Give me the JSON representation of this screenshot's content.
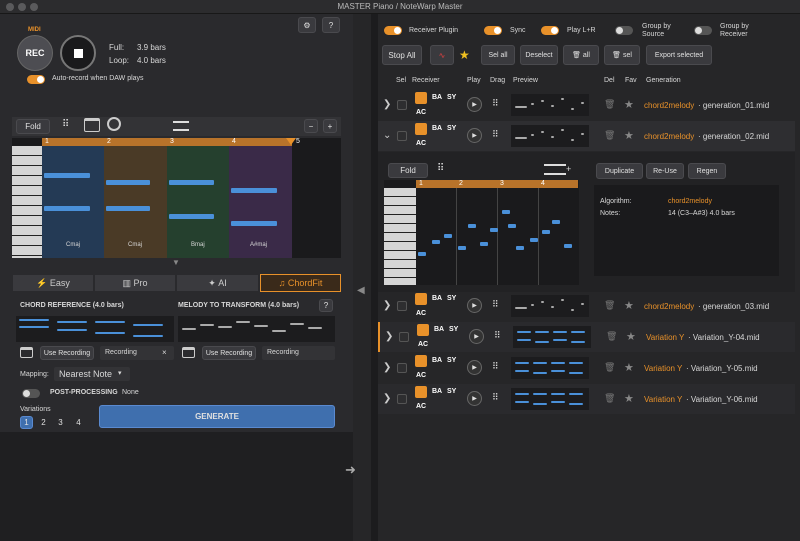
{
  "window": {
    "title": "MASTER Piano / NoteWarp Master"
  },
  "recorder": {
    "midi": "MIDI",
    "rec": "REC",
    "full_label": "Full:",
    "full_value": "3.9 bars",
    "loop_label": "Loop:",
    "loop_value": "4.0 bars",
    "auto_record": "Auto-record when DAW plays"
  },
  "top_icons": {
    "settings": "⚙",
    "help": "?"
  },
  "roll_toolbar": {
    "fold": "Fold",
    "minus": "−",
    "plus": "+"
  },
  "piano_roll": {
    "bars": [
      "1",
      "2",
      "3",
      "4",
      "5"
    ],
    "chords": [
      "Cmaj",
      "Cmaj",
      "Bmaj",
      "A#maj"
    ]
  },
  "tabs": [
    {
      "label": "Easy",
      "icon": "⚡"
    },
    {
      "label": "Pro",
      "icon": "▥"
    },
    {
      "label": "AI",
      "icon": "✦"
    },
    {
      "label": "ChordFit",
      "icon": "♫"
    }
  ],
  "chordfit": {
    "chord_ref": "CHORD REFERENCE (4.0 bars)",
    "melody": "MELODY TO TRANSFORM (4.0 bars)",
    "help": "?",
    "use_recording": "Use Recording",
    "recording": "Recording",
    "clear": "×",
    "mapping_label": "Mapping:",
    "mapping_value": "Nearest Note",
    "post_label": "POST-PROCESSING",
    "post_value": "None",
    "variations_label": "Variations",
    "variations": [
      "1",
      "2",
      "3",
      "4"
    ],
    "generate": "GENERATE"
  },
  "center_arrows": {
    "up": "◀",
    "right": "➜",
    "down": "▼"
  },
  "right_header": {
    "receiver_plugin": "Receiver Plugin",
    "sync": "Sync",
    "play_lr": "Play L+R",
    "group_source": "Group by Source",
    "group_receiver": "Group by Receiver",
    "stop_all": "Stop All",
    "sel_all": "Sel all",
    "deselect": "Deselect",
    "del_all": "all",
    "del_sel": "sel",
    "export": "Export selected"
  },
  "columns": [
    "Sel",
    "Receiver",
    "Play",
    "Drag",
    "Preview",
    "Del",
    "Fav",
    "Generation"
  ],
  "receiver_tags": {
    "ba": "BA",
    "sy": "SY",
    "ac": "AC"
  },
  "generations": [
    {
      "source": "chord2melody",
      "file": "generation_01.mid",
      "expanded": false,
      "chevron": "❯"
    },
    {
      "source": "chord2melody",
      "file": "generation_02.mid",
      "expanded": true,
      "chevron": "⌄"
    },
    {
      "source": "chord2melody",
      "file": "generation_03.mid",
      "expanded": false,
      "chevron": "❯"
    },
    {
      "source": "Variation Y",
      "file": "Variation_Y-04.mid",
      "expanded": false,
      "chevron": "❯"
    },
    {
      "source": "Variation Y",
      "file": "Variation_Y-05.mid",
      "expanded": false,
      "chevron": "❯"
    },
    {
      "source": "Variation Y",
      "file": "Variation_Y-06.mid",
      "expanded": false,
      "chevron": "❯"
    }
  ],
  "expanded_panel": {
    "fold": "Fold",
    "bars": [
      "1",
      "2",
      "3",
      "4"
    ],
    "duplicate": "Duplicate",
    "reuse": "Re-Use",
    "regen": "Regen",
    "algorithm_label": "Algorithm:",
    "algorithm_value": "chord2melody",
    "notes_label": "Notes:",
    "notes_value": "14 (C3–A#3)  4.0 bars"
  },
  "colors": {
    "accent": "#e8912a",
    "note": "#4a90d9",
    "generate": "#3f6fae"
  }
}
